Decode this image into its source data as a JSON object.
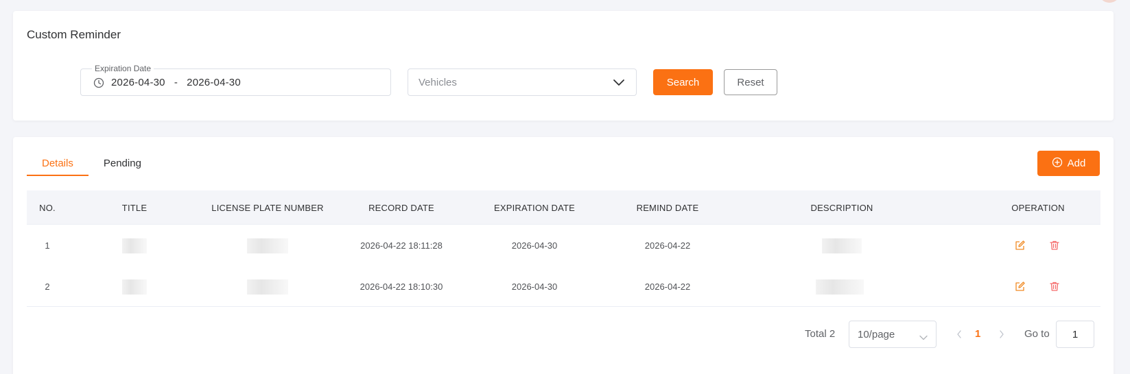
{
  "filter": {
    "title": "Custom Reminder",
    "expiration_label": "Expiration Date",
    "date_start": "2026-04-30",
    "date_separator": "-",
    "date_end": "2026-04-30",
    "vehicles_placeholder": "Vehicles",
    "search_label": "Search",
    "reset_label": "Reset"
  },
  "tabs": [
    {
      "label": "Details",
      "active": true
    },
    {
      "label": "Pending",
      "active": false
    }
  ],
  "add_label": "Add",
  "table": {
    "headers": [
      "NO.",
      "TITLE",
      "LICENSE PLATE NUMBER",
      "RECORD DATE",
      "EXPIRATION DATE",
      "REMIND DATE",
      "DESCRIPTION",
      "OPERATION"
    ],
    "rows": [
      {
        "no": "1",
        "record_date": "2026-04-22 18:11:28",
        "expiration_date": "2026-04-30",
        "remind_date": "2026-04-22"
      },
      {
        "no": "2",
        "record_date": "2026-04-22 18:10:30",
        "expiration_date": "2026-04-30",
        "remind_date": "2026-04-22"
      }
    ]
  },
  "pagination": {
    "total": "Total 2",
    "page_size": "10/page",
    "current_page": "1",
    "goto_label": "Go to",
    "goto_value": "1"
  },
  "colors": {
    "accent": "#fb7113",
    "danger": "#f56c6c",
    "background": "#f4f5f9"
  }
}
